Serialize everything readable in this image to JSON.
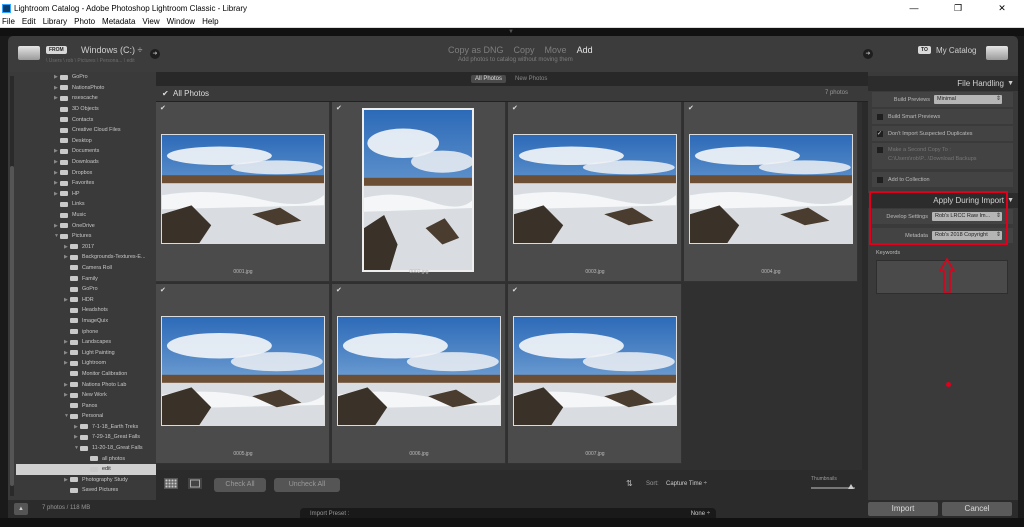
{
  "window": {
    "title": "Lightroom Catalog - Adobe Photoshop Lightroom Classic - Library",
    "controls": {
      "minimize": "—",
      "maximize": "❐",
      "close": "✕"
    }
  },
  "menu": [
    "File",
    "Edit",
    "Library",
    "Photo",
    "Metadata",
    "View",
    "Window",
    "Help"
  ],
  "header": {
    "from_badge": "FROM",
    "source": "Windows (C:) ÷",
    "source_path": "\\ Users \\ rob \\ Pictures \\ Persona... \\ edit",
    "modes": [
      "Copy as DNG",
      "Copy",
      "Move",
      "Add"
    ],
    "active_mode": "Add",
    "mode_desc": "Add photos to catalog without moving them",
    "to_badge": "TO",
    "destination": "My Catalog"
  },
  "folders": [
    {
      "label": "GoPro",
      "depth": 1,
      "tri": "▶"
    },
    {
      "label": "NationsPhoto",
      "depth": 1,
      "tri": "▶"
    },
    {
      "label": "nsescache",
      "depth": 1,
      "tri": "▶"
    },
    {
      "label": "3D Objects",
      "depth": 1,
      "tri": ""
    },
    {
      "label": "Contacts",
      "depth": 1,
      "tri": ""
    },
    {
      "label": "Creative Cloud Files",
      "depth": 1,
      "tri": ""
    },
    {
      "label": "Desktop",
      "depth": 1,
      "tri": ""
    },
    {
      "label": "Documents",
      "depth": 1,
      "tri": "▶"
    },
    {
      "label": "Downloads",
      "depth": 1,
      "tri": "▶"
    },
    {
      "label": "Dropbox",
      "depth": 1,
      "tri": "▶"
    },
    {
      "label": "Favorites",
      "depth": 1,
      "tri": "▶"
    },
    {
      "label": "HP",
      "depth": 1,
      "tri": "▶"
    },
    {
      "label": "Links",
      "depth": 1,
      "tri": ""
    },
    {
      "label": "Music",
      "depth": 1,
      "tri": ""
    },
    {
      "label": "OneDrive",
      "depth": 1,
      "tri": "▶"
    },
    {
      "label": "Pictures",
      "depth": 1,
      "tri": "▼"
    },
    {
      "label": "2017",
      "depth": 2,
      "tri": "▶"
    },
    {
      "label": "Backgrounds-Textures-E...",
      "depth": 2,
      "tri": "▶"
    },
    {
      "label": "Camera Roll",
      "depth": 2,
      "tri": ""
    },
    {
      "label": "Family",
      "depth": 2,
      "tri": ""
    },
    {
      "label": "GoPro",
      "depth": 2,
      "tri": ""
    },
    {
      "label": "HDR",
      "depth": 2,
      "tri": "▶"
    },
    {
      "label": "Headshots",
      "depth": 2,
      "tri": ""
    },
    {
      "label": "ImageQuix",
      "depth": 2,
      "tri": ""
    },
    {
      "label": "iphone",
      "depth": 2,
      "tri": ""
    },
    {
      "label": "Landscapes",
      "depth": 2,
      "tri": "▶"
    },
    {
      "label": "Light Painting",
      "depth": 2,
      "tri": "▶"
    },
    {
      "label": "Lightroom",
      "depth": 2,
      "tri": "▶"
    },
    {
      "label": "Monitor Calibration",
      "depth": 2,
      "tri": ""
    },
    {
      "label": "Nations Photo Lab",
      "depth": 2,
      "tri": "▶"
    },
    {
      "label": "New Work",
      "depth": 2,
      "tri": "▶"
    },
    {
      "label": "Panos",
      "depth": 2,
      "tri": ""
    },
    {
      "label": "Personal",
      "depth": 2,
      "tri": "▼"
    },
    {
      "label": "7-1-18_Earth Treks",
      "depth": 3,
      "tri": "▶"
    },
    {
      "label": "7-29-18_Great Falls",
      "depth": 3,
      "tri": "▶"
    },
    {
      "label": "11-20-18_Great Falls",
      "depth": 3,
      "tri": "▼"
    },
    {
      "label": "all photos",
      "depth": 4,
      "tri": ""
    },
    {
      "label": "edit",
      "depth": 4,
      "tri": "",
      "selected": true
    },
    {
      "label": "Photography Study",
      "depth": 2,
      "tri": "▶"
    },
    {
      "label": "Saved Pictures",
      "depth": 2,
      "tri": ""
    }
  ],
  "filter_tabs": [
    "All Photos",
    "New Photos"
  ],
  "grid": {
    "heading": "All Photos",
    "count": "7 photos",
    "photos": [
      "0001.jpg",
      "0002.jpg",
      "0003.jpg",
      "0004.jpg",
      "0005.jpg",
      "0006.jpg",
      "0007.jpg"
    ],
    "selected_index": 1
  },
  "toolbar": {
    "check_all": "Check All",
    "uncheck_all": "Uncheck All",
    "sort_label": "Sort:",
    "sort_value": "Capture Time ÷",
    "thumbnails_label": "Thumbnails",
    "thumbnail_size_fraction": 0.9
  },
  "file_handling": {
    "title": "File Handling",
    "build_previews_label": "Build Previews",
    "build_previews_value": "Minimal",
    "smart_previews": "Build Smart Previews",
    "no_duplicates": "Don't Import Suspected Duplicates",
    "second_copy": "Make a Second Copy To :",
    "second_copy_path": "C:\\Users\\rob\\P...\\Download Backups",
    "add_collection": "Add to Collection"
  },
  "apply": {
    "title": "Apply During Import",
    "develop_label": "Develop Settings",
    "develop_value": "Rob's LRCC Raw Im...",
    "metadata_label": "Metadata",
    "metadata_value": "Rob's 2018 Copyright",
    "keywords_label": "Keywords"
  },
  "bottom": {
    "status": "7 photos / 118 MB",
    "preset_label": "Import Preset :",
    "preset_value": "None ÷",
    "import": "Import",
    "cancel": "Cancel"
  },
  "colors": {
    "highlight": "#e0001b"
  }
}
